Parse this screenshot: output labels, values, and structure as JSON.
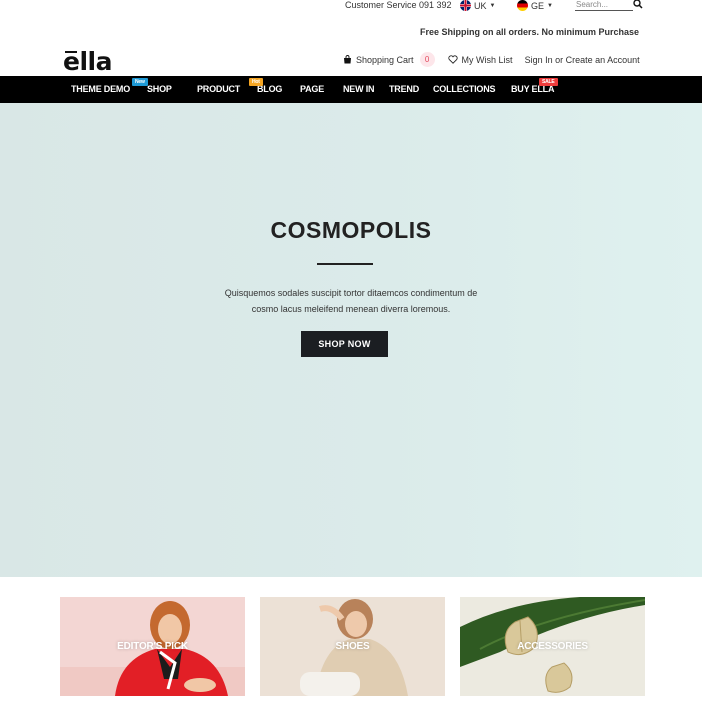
{
  "topbar": {
    "customer_service": "Customer Service 091 392",
    "currency": "UK",
    "language": "GE",
    "search_placeholder": "Search...",
    "shipping_note": "Free Shipping on all orders. No minimum Purchase"
  },
  "header": {
    "logo": "ella",
    "cart_label": "Shopping Cart",
    "cart_count": "0",
    "wishlist_label": "My Wish List",
    "account_label": "Sign In or Create an Account"
  },
  "nav": {
    "items": [
      {
        "label": "THEME DEMO"
      },
      {
        "label": "SHOP",
        "tag": "New"
      },
      {
        "label": "PRODUCT"
      },
      {
        "label": "BLOG",
        "tag": "Hot"
      },
      {
        "label": "PAGE"
      },
      {
        "label": "NEW IN"
      },
      {
        "label": "TREND"
      },
      {
        "label": "COLLECTIONS"
      },
      {
        "label": "BUY ELLA",
        "tag": "SALE"
      }
    ]
  },
  "hero": {
    "title": "COSMOPOLIS",
    "text_line1": "Quisquemos sodales suscipit tortor ditaemcos condimentum de",
    "text_line2": "cosmo lacus meleifend menean diverra loremous.",
    "button": "SHOP NOW"
  },
  "categories": [
    {
      "label": "EDITOR'S PICK"
    },
    {
      "label": "SHOES"
    },
    {
      "label": "ACCESSORIES"
    }
  ],
  "colors": {
    "nav_bg": "#000000",
    "hero_bg": "#dbebea",
    "button_bg": "#1b1e22",
    "tag_new": "#1e9ad6",
    "tag_hot": "#f6a623",
    "tag_sale": "#ef3d3d"
  }
}
